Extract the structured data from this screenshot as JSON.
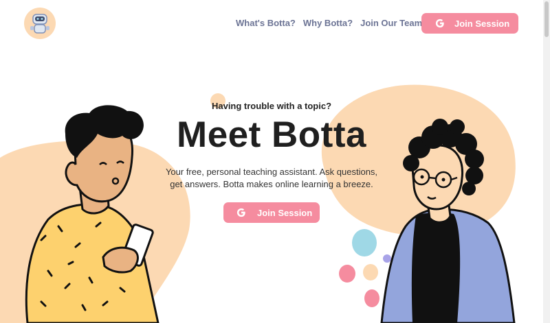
{
  "logo": {
    "icon": "robot-icon",
    "color": "#fcd9b3"
  },
  "nav": {
    "links": [
      "What's Botta?",
      "Why Botta?",
      "Join Our Team"
    ],
    "join_label": "Join Session"
  },
  "hero": {
    "tagline": "Having trouble with a topic?",
    "title": "Meet Botta",
    "description": "Your free, personal teaching assistant. Ask questions, get answers. Botta makes online learning a breeze.",
    "join_label": "Join Session"
  },
  "colors": {
    "accent": "#f58c9f",
    "nav_text": "#6b7394",
    "blob": "#fcd9b3"
  }
}
